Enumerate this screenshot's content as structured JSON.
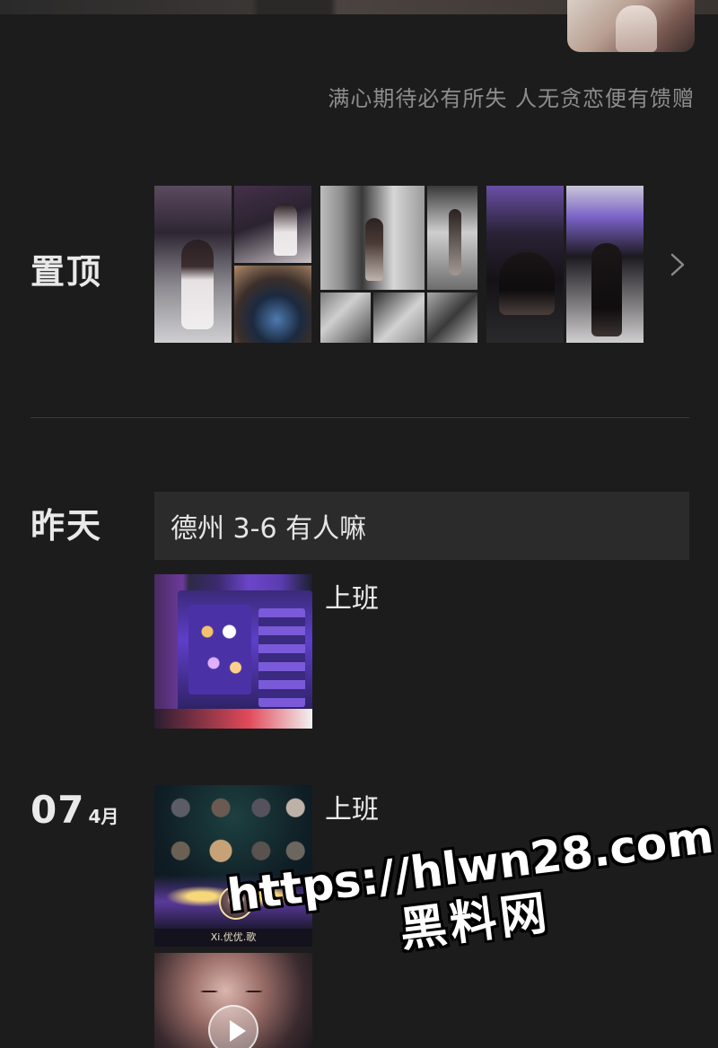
{
  "profile": {
    "signature": "满心期待必有所失 人无贪恋便有馈赠"
  },
  "pinned": {
    "label": "置顶",
    "icon": "chevron-right-icon"
  },
  "yesterday": {
    "label": "昨天",
    "text_post": "德州 3-6 有人嘛",
    "media_post_caption": "上班"
  },
  "dated_group": {
    "day": "07",
    "month": "4月",
    "post_caption": "上班",
    "game_name_tag": "Xi.优优.歌"
  },
  "watermark": {
    "url": "https://hlwn28.com",
    "site": "黑料网"
  },
  "colors": {
    "background": "#1c1c1c",
    "text_post_bg": "#2b2b2b",
    "muted_text": "#8d8d8d"
  }
}
